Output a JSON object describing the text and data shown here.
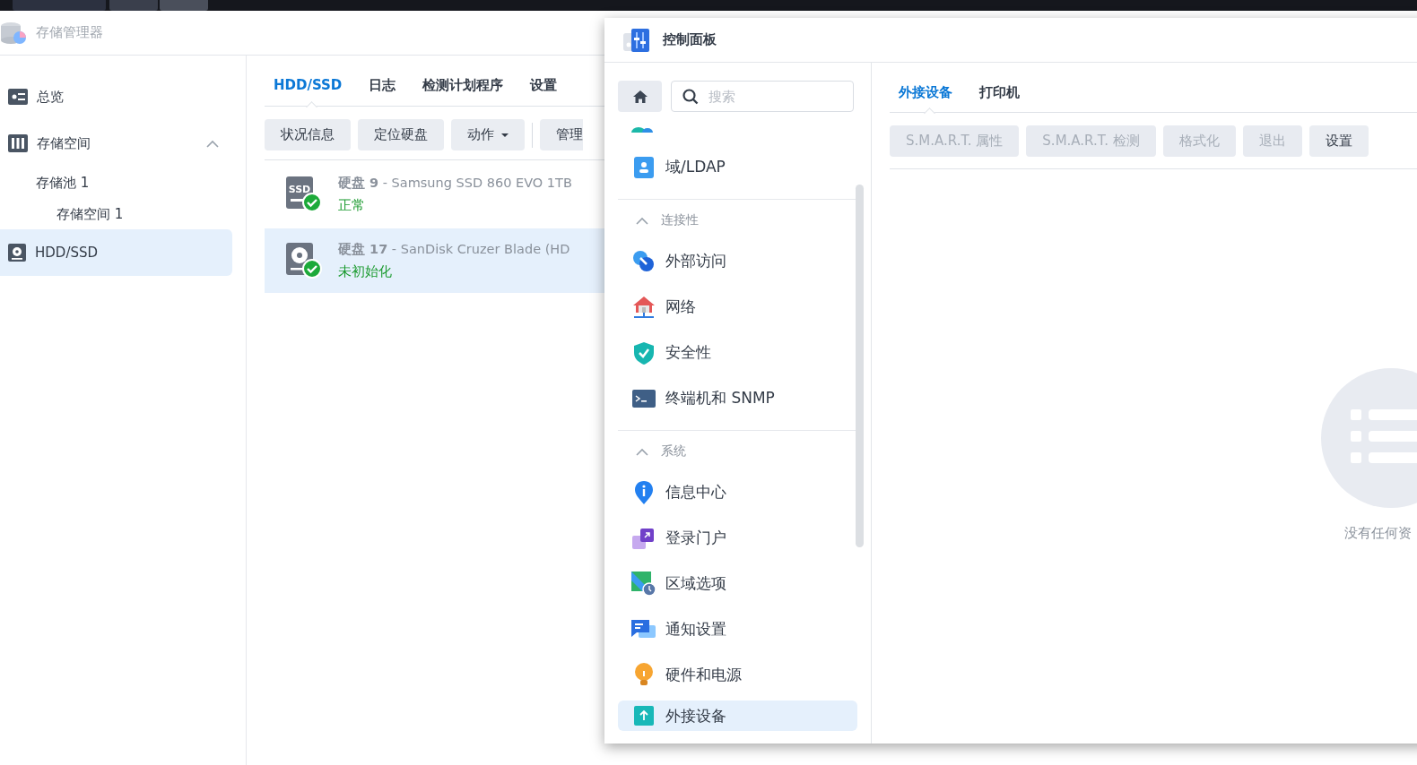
{
  "storage_manager": {
    "title": "存储管理器",
    "sidebar": [
      {
        "label": "总览",
        "selected": false
      },
      {
        "label": "存储空间",
        "selected": false,
        "expanded": true,
        "children": [
          {
            "label": "存储池 1",
            "selected": false,
            "children": [
              {
                "label": "存储空间 1",
                "selected": false
              }
            ]
          }
        ]
      },
      {
        "label": "HDD/SSD",
        "selected": true
      }
    ],
    "tabs": [
      {
        "label": "HDD/SSD",
        "selected": true
      },
      {
        "label": "日志",
        "selected": false
      },
      {
        "label": "检测计划程序",
        "selected": false
      },
      {
        "label": "设置",
        "selected": false
      }
    ],
    "buttons": [
      {
        "label": "状况信息",
        "kind": "plain"
      },
      {
        "label": "定位硬盘",
        "kind": "plain"
      },
      {
        "label": "动作",
        "kind": "dropdown"
      },
      {
        "label": "管理",
        "kind": "plain"
      }
    ],
    "disks": [
      {
        "kind": "ssd",
        "icon_label": "SSD",
        "title": "**硬盘 9** - Samsung SSD 860 EVO 1TB",
        "status": "正常",
        "selected": false
      },
      {
        "kind": "hdd",
        "title": "**硬盘 17** - SanDisk Cruzer Blade (HD",
        "status": "未初始化",
        "selected": true
      }
    ]
  },
  "control_panel": {
    "title": "控制面板",
    "search": {
      "placeholder": "搜索"
    },
    "groups": [
      {
        "items": [
          {
            "label": "域/LDAP",
            "selected": false
          }
        ]
      },
      {
        "title": "连接性",
        "expanded": true,
        "items": [
          {
            "label": "外部访问",
            "selected": false
          },
          {
            "label": "网络",
            "selected": false
          },
          {
            "label": "安全性",
            "selected": false
          },
          {
            "label": "终端机和 SNMP",
            "selected": false
          }
        ]
      },
      {
        "title": "系统",
        "expanded": true,
        "items": [
          {
            "label": "信息中心",
            "selected": false
          },
          {
            "label": "登录门户",
            "selected": false
          },
          {
            "label": "区域选项",
            "selected": false
          },
          {
            "label": "通知设置",
            "selected": false
          },
          {
            "label": "硬件和电源",
            "selected": false
          },
          {
            "label": "外接设备",
            "selected": true
          }
        ]
      }
    ],
    "tabs": [
      {
        "label": "外接设备",
        "selected": true
      },
      {
        "label": "打印机",
        "selected": false
      }
    ],
    "buttons": [
      {
        "label": "S.M.A.R.T. 属性",
        "disabled": true
      },
      {
        "label": "S.M.A.R.T. 检测",
        "disabled": true
      },
      {
        "label": "格式化",
        "disabled": true
      },
      {
        "label": "退出",
        "disabled": true
      },
      {
        "label": "设置",
        "disabled": false
      }
    ],
    "empty_text": "没有任何资"
  }
}
